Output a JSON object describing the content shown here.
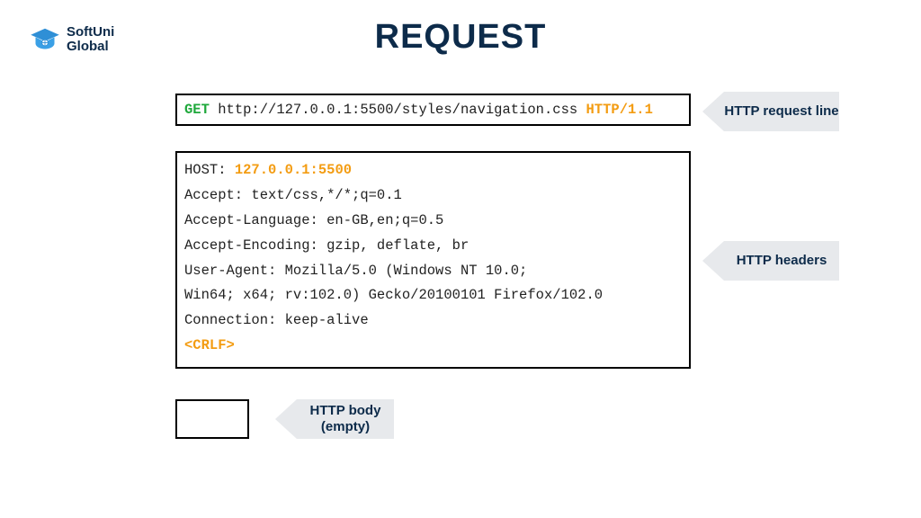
{
  "logo": {
    "line1": "SoftUni",
    "line2": "Global"
  },
  "title": "REQUEST",
  "colors": {
    "green": "#1ea83b",
    "orange": "#f39c12",
    "navy": "#0d2b4a",
    "labelBg": "#e7e9ec"
  },
  "request_line": {
    "method": "GET",
    "url": "http://127.0.0.1:5500/styles/navigation.css",
    "version": "HTTP/1.1"
  },
  "headers": {
    "host_label": "HOST:",
    "host_value": "127.0.0.1:5500",
    "lines": [
      "Accept: text/css,*/*;q=0.1",
      "Accept-Language: en-GB,en;q=0.5",
      "Accept-Encoding: gzip, deflate, br",
      "User-Agent: Mozilla/5.0 (Windows NT 10.0;",
      "Win64; x64; rv:102.0) Gecko/20100101 Firefox/102.0",
      "Connection: keep-alive"
    ],
    "crlf": "<CRLF>"
  },
  "labels": {
    "request_line": "HTTP request line",
    "headers": "HTTP headers",
    "body": "HTTP body (empty)"
  }
}
